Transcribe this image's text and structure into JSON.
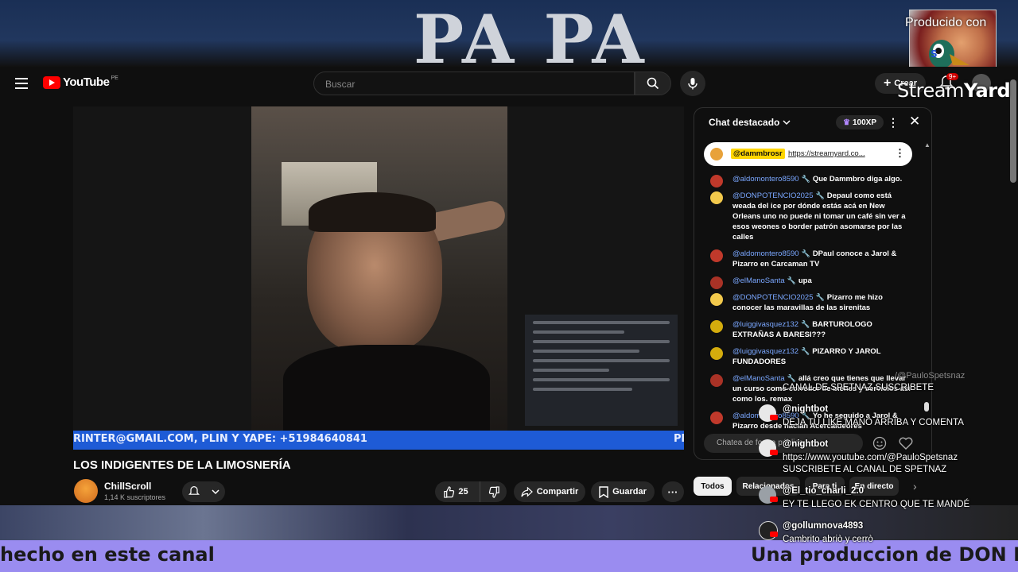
{
  "background": {
    "top_sign": "PA PA",
    "ticker_left": "hecho en este canal",
    "ticker_right": "Una produccion de DON M"
  },
  "header": {
    "logo_text": "YouTube",
    "logo_country": "PE",
    "search_placeholder": "Buscar",
    "create_label": "Crear",
    "notifications_badge": "9+"
  },
  "video": {
    "overlay_ticker": "RINTER@GMAIL.COM, PLIN Y YAPE: +51984640841",
    "overlay_ticker_end": "Pl",
    "title": "LOS INDIGENTES DE LA LIMOSNERÍA",
    "channel_name": "ChillScroll",
    "subscribers": "1,14 K suscriptores",
    "likes": "25",
    "share_label": "Compartir",
    "save_label": "Guardar"
  },
  "chat": {
    "header": "Chat destacado",
    "xp_badge": "100XP",
    "pinned": {
      "user": "@dammbrosr",
      "link": "https://streamyard.co..."
    },
    "messages": [
      {
        "user": "@aldomontero8590",
        "text": "Que Dammbro diga algo.",
        "color": "#c0392b"
      },
      {
        "user": "@DONPOTENCIO2025",
        "text": "Depaul como está weada del ice por dónde estás acá en New Orleans uno no puede ni tomar un café sin ver a esos weones o border patrón asomarse por las calles",
        "color": "#f2c94c"
      },
      {
        "user": "@aldomontero8590",
        "text": "DPaul conoce a Jarol & Pizarro en Carcaman TV",
        "color": "#c0392b"
      },
      {
        "user": "@elManoSanta",
        "text": "upa",
        "color": "#a93226"
      },
      {
        "user": "@DONPOTENCIO2025",
        "text": "Pizarro me hizo conocer las maravillas de las sirenitas",
        "color": "#f2c94c"
      },
      {
        "user": "@luiggivasquez132",
        "text": "BARTUROLOGO EXTRAÑAS A BARESI???",
        "color": "#d4ac0d"
      },
      {
        "user": "@luiggivasquez132",
        "text": "PIZARRO Y JAROL FUNDADORES",
        "color": "#d4ac0d"
      },
      {
        "user": "@elManoSanta",
        "text": "allá creo que tienes que llevar un curso como corredor de bienes y servicios así como los. remax",
        "color": "#a93226"
      },
      {
        "user": "@aldomontero8590",
        "text": "Yo he seguido a Jarol & Pizarro desde hacían Acercaideores",
        "color": "#c0392b"
      }
    ],
    "input_placeholder": "Chatea de forma pública",
    "chips": [
      "Todos",
      "Relacionados",
      "Para ti",
      "En directo"
    ]
  },
  "streamyard": {
    "producido": "Producido con",
    "logo_a": "Stream",
    "logo_b": "Yard",
    "faded_text": "/@PauloSpetsnaz",
    "overlay_messages": [
      {
        "line": "CANAL DE SPETNAZ SUSCRIBETE"
      },
      {
        "user": "@nightbot",
        "line": "DEJA TU LIKE MANO ARRIBA Y COMENTA"
      },
      {
        "user": "@nightbot",
        "line1": "https://www.youtube.com/@PauloSpetsnaz",
        "line2": "SUSCRIBETE AL CANAL DE SPETNAZ"
      },
      {
        "user": "@El_tio_charli_2.0",
        "line": "EY TE LLEGO EK CENTRO QUE TE MANDÉ"
      },
      {
        "user": "@gollumnova4893",
        "line": "Cambrito abriò y cerrò"
      }
    ]
  },
  "colors": {
    "background": "#0f0f0f",
    "youtube_red": "#ff0000",
    "chat_username": "#7aa7ff",
    "ticker": "#9a8cf0",
    "video_ticker": "#1e5bd6"
  }
}
